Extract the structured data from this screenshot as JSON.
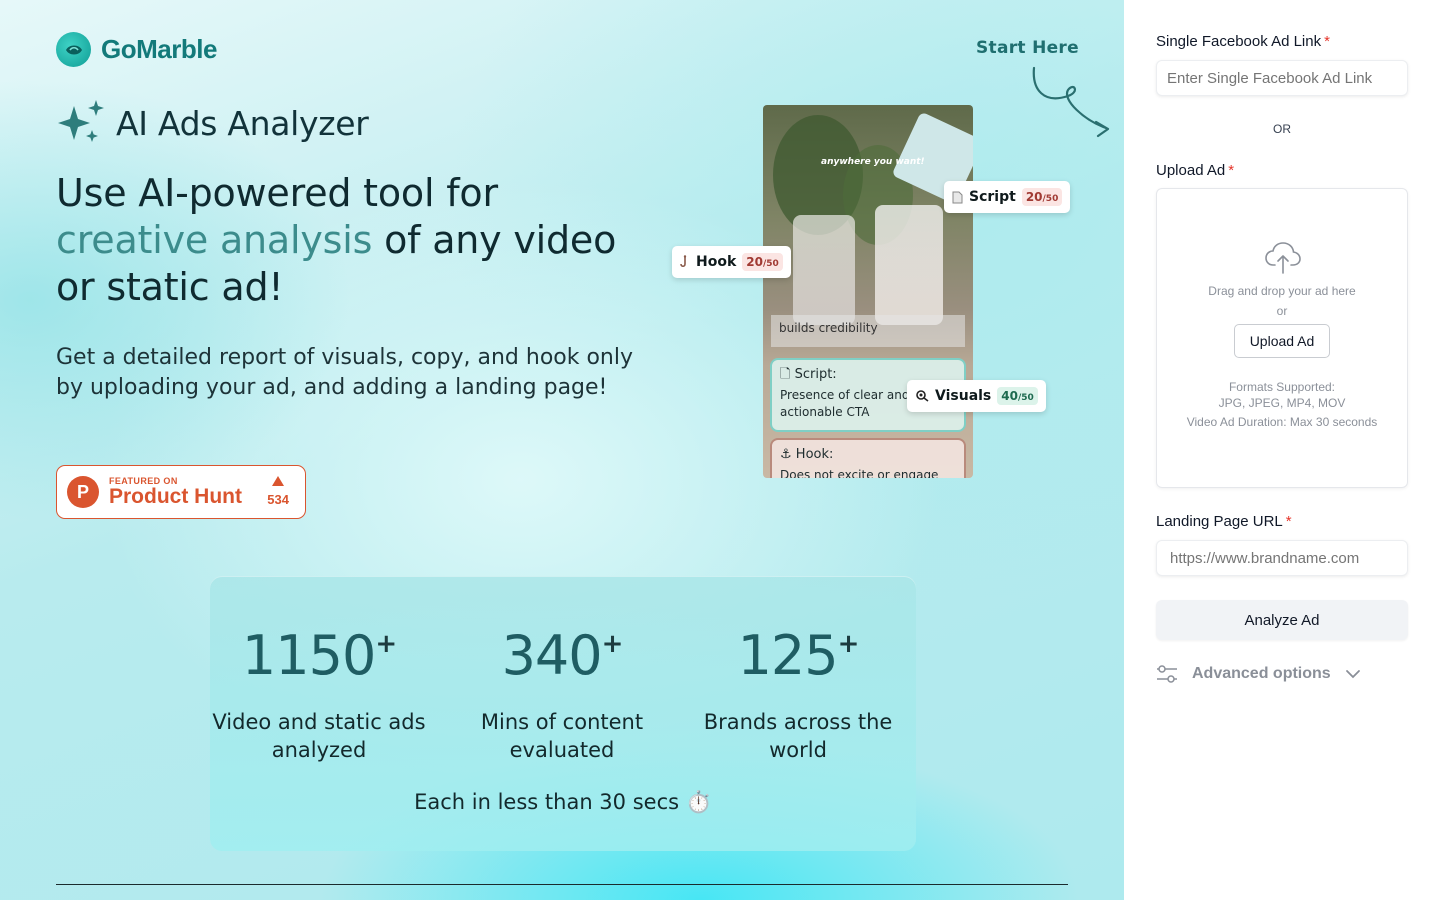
{
  "brand": {
    "name": "GoMarble"
  },
  "start_here": "Start Here",
  "app_title": "AI Ads Analyzer",
  "headline": {
    "line1": "Use AI-powered tool for",
    "accent": "creative analysis",
    "line2_rest": " of any video",
    "line3": "or static ad!"
  },
  "subhead": "Get a detailed report of visuals, copy, and hook only by uploading your ad, and adding a landing page!",
  "product_hunt": {
    "featured": "FEATURED ON",
    "name": "Product Hunt",
    "letter": "P",
    "votes": "534"
  },
  "preview": {
    "caption": "anywhere you want!",
    "faded_text": "builds credibility",
    "script_card": {
      "title": "Script:",
      "body": "Presence of clear and actionable CTA"
    },
    "hook_card": {
      "title": "Hook:",
      "body": "Does not excite or engage"
    }
  },
  "tags": {
    "script": {
      "label": "Script",
      "score": "20",
      "of": "/50"
    },
    "hook": {
      "label": "Hook",
      "score": "20",
      "of": "/50"
    },
    "visuals": {
      "label": "Visuals",
      "score": "40",
      "of": "/50"
    }
  },
  "stats": [
    {
      "value": "1150",
      "plus": "+",
      "label": "Video and static ads analyzed"
    },
    {
      "value": "340",
      "plus": "+",
      "label": "Mins of content evaluated"
    },
    {
      "value": "125",
      "plus": "+",
      "label": "Brands across the world"
    }
  ],
  "stats_footer": "Each in less than 30 secs ⏱️",
  "form": {
    "ad_link_label": "Single Facebook Ad Link",
    "ad_link_placeholder": "Enter Single Facebook Ad Link",
    "or": "OR",
    "upload_label": "Upload Ad",
    "required": "*",
    "dropzone": {
      "drag_text": "Drag and drop your ad here",
      "or": "or",
      "button": "Upload Ad",
      "formats_title": "Formats Supported:",
      "formats": "JPG, JPEG, MP4, MOV",
      "duration": "Video Ad Duration: Max 30 seconds"
    },
    "landing_label": "Landing Page URL",
    "landing_placeholder": "https://www.brandname.com",
    "analyze_button": "Analyze Ad",
    "advanced": "Advanced options"
  },
  "colors": {
    "accent_teal": "#3c8c8c",
    "product_hunt": "#da552f",
    "required": "#e5342a"
  }
}
